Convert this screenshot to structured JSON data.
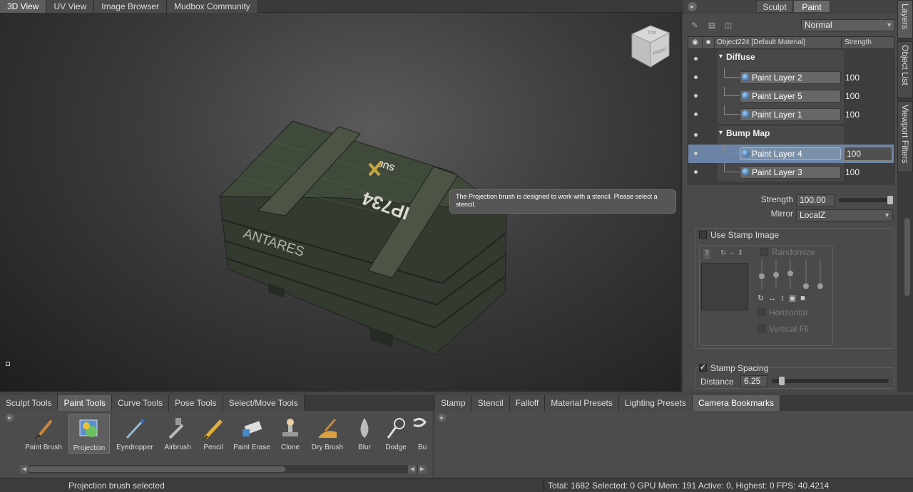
{
  "view_tabs": [
    "3D View",
    "UV View",
    "Image Browser",
    "Mudbox Community"
  ],
  "viewport": {
    "tooltip": "The Projection brush is designed to work with a stencil. Please select a stencil.",
    "crate_text": {
      "top": "SU8",
      "serial": "IP734",
      "side": "ANTARES"
    },
    "viewcube": {
      "top": "TOP",
      "front": "FRONT"
    }
  },
  "right_panel": {
    "mode_tabs": [
      "Sculpt",
      "Paint"
    ],
    "blend_mode": "Normal",
    "layer_table": {
      "object_header": "Object224 [Default Material]",
      "strength_header": "Strength",
      "groups": [
        {
          "name": "Diffuse",
          "layers": [
            {
              "name": "Paint Layer 2",
              "strength": "100"
            },
            {
              "name": "Paint Layer 5",
              "strength": "100"
            },
            {
              "name": "Paint Layer 1",
              "strength": "100"
            }
          ]
        },
        {
          "name": "Bump Map",
          "layers": [
            {
              "name": "Paint Layer 4",
              "strength": "100"
            },
            {
              "name": "Paint Layer 3",
              "strength": "100"
            }
          ]
        }
      ]
    },
    "properties": {
      "strength_label": "Strength",
      "strength_value": "100.00",
      "mirror_label": "Mirror",
      "mirror_value": "LocalZ",
      "use_stamp_image": "Use Stamp Image",
      "randomize": "Randomize",
      "horizontal": "Horizontal",
      "vertical": "Vertical Fli",
      "stamp_spacing": "Stamp Spacing",
      "distance_label": "Distance",
      "distance_value": "6.25"
    },
    "side_tabs": [
      "Layers",
      "Object List",
      "Viewport Filters"
    ]
  },
  "shelf": {
    "tabs": [
      "Sculpt Tools",
      "Paint Tools",
      "Curve Tools",
      "Pose Tools",
      "Select/Move Tools"
    ],
    "tools": [
      "Paint Brush",
      "Projection",
      "Eyedropper",
      "Airbrush",
      "Pencil",
      "Paint Erase",
      "Clone",
      "Dry Brush",
      "Blur",
      "Dodge",
      "Bu"
    ]
  },
  "tray": {
    "tabs": [
      "Stamp",
      "Stencil",
      "Falloff",
      "Material Presets",
      "Lighting Presets",
      "Camera Bookmarks"
    ]
  },
  "status": {
    "message": "Projection brush selected",
    "stats": "Total: 1682  Selected: 0 GPU Mem: 191  Active: 0, Highest: 0  FPS: 40.4214"
  }
}
